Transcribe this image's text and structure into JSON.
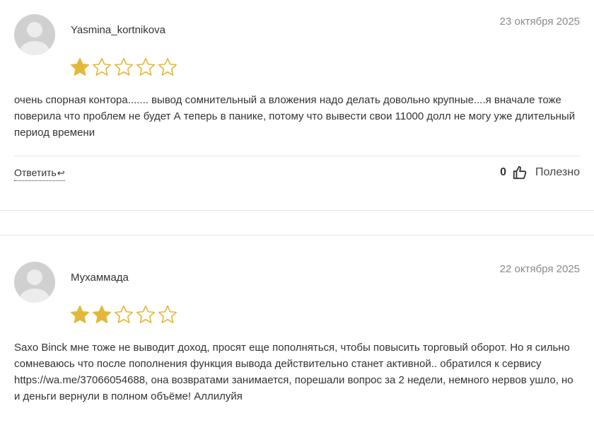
{
  "colors": {
    "star_filled": "#E3B83A",
    "star_empty_outline": "#E3B83A",
    "date_text": "#8A8A8A",
    "body_text": "#333333",
    "divider": "#E6E6E6"
  },
  "reviews": [
    {
      "author": "Yasmina_kortnikova",
      "date": "23 октября 2025",
      "rating": 1,
      "max_rating": 5,
      "text": "очень спорная контора....... вывод сомнительный а вложения надо делать довольно крупные....я вначале тоже поверила что проблем не будет А теперь в панике, потому что вывести свои 11000 долл не могу уже длительный период времени",
      "reply_label": "Ответить",
      "reply_icon": "reply-arrow-icon",
      "helpful_count": "0",
      "helpful_icon": "thumbs-up-icon",
      "helpful_label": "Полезно"
    },
    {
      "author": "Мухаммада",
      "date": "22 октября 2025",
      "rating": 2,
      "max_rating": 5,
      "text_before_link": "Saxo Binck мне тоже не выводит доход, просят еще пополняться, чтобы повысить торговый оборот. Но я сильно сомневаюсь что после пополнения функция вывода действительно станет активной.. обратился к сервису ",
      "link_text": "https://wa.me/37066054688",
      "text_after_link": ", она возвратами занимается, порешали вопрос за 2 недели, немного нервов ушло, но и деньги вернули в полном объёме! Аллилуйя"
    }
  ]
}
